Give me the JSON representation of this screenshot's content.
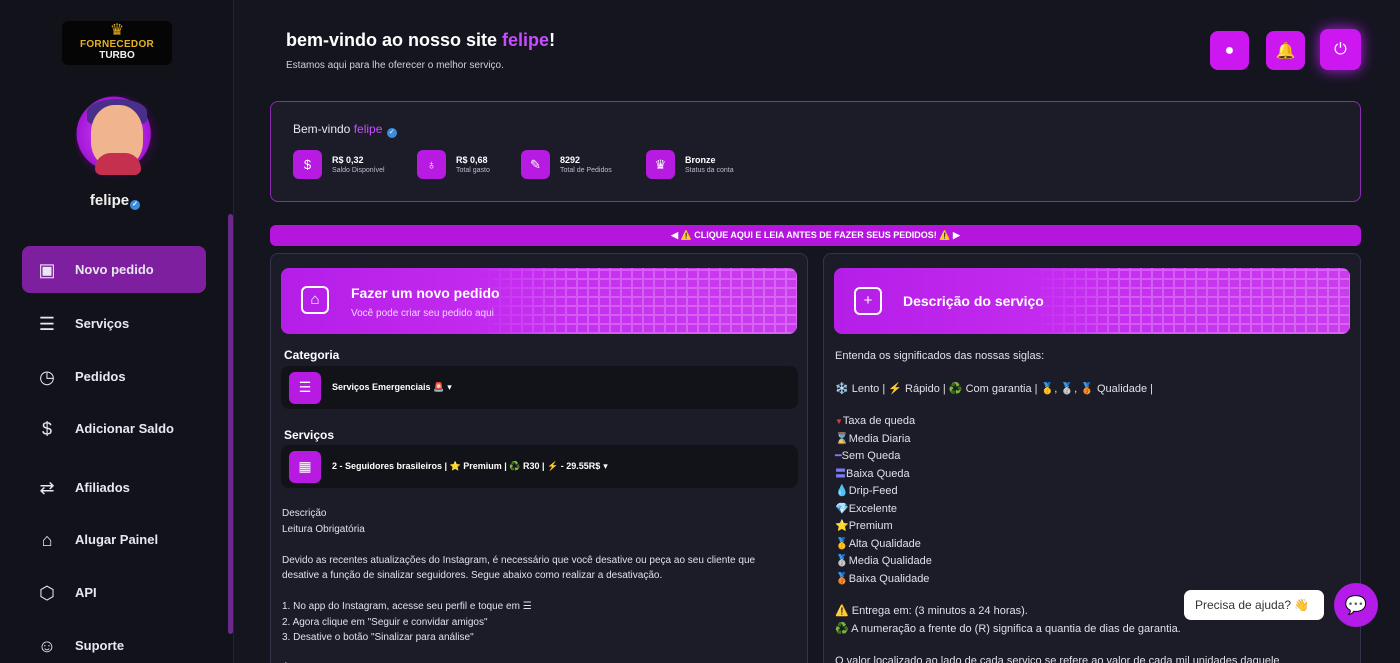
{
  "brand": {
    "logo_line1": "FORNECEDOR",
    "logo_line2": "TURBO",
    "crown": "♛"
  },
  "user": {
    "name": "felipe"
  },
  "nav": [
    {
      "label": "Novo pedido",
      "icon": "▣",
      "icon_name": "gift-box-icon",
      "active": true
    },
    {
      "label": "Serviços",
      "icon": "☰",
      "icon_name": "list-icon"
    },
    {
      "label": "Pedidos",
      "icon": "◷",
      "icon_name": "orders-clock-icon"
    },
    {
      "label": "Adicionar Saldo",
      "icon": "$",
      "icon_name": "add-balance-icon"
    },
    {
      "label": "Afiliados",
      "icon": "⇄",
      "icon_name": "handshake-icon"
    },
    {
      "label": "Alugar Painel",
      "icon": "⌂",
      "icon_name": "store-icon"
    },
    {
      "label": "API",
      "icon": "⬡",
      "icon_name": "api-icon"
    },
    {
      "label": "Suporte",
      "icon": "☺",
      "icon_name": "support-icon"
    }
  ],
  "header": {
    "title_prefix": "bem-vindo ao nosso site ",
    "title_name": "felipe",
    "title_suffix": "!",
    "subtitle": "Estamos aqui para lhe oferecer o melhor serviço.",
    "buttons": [
      {
        "icon": "●",
        "icon_name": "user-icon"
      },
      {
        "icon": "🔔",
        "icon_name": "bell-icon"
      },
      {
        "icon": "⏻",
        "icon_name": "power-icon"
      }
    ]
  },
  "stats": {
    "hello": "Bem-vindo ",
    "name": "felipe",
    "items": [
      {
        "value": "R$ 0,32",
        "label": "Saldo Disponível",
        "icon": "$",
        "icon_name": "dollar-icon"
      },
      {
        "value": "R$ 0,68",
        "label": "Total gasto",
        "icon": "♁",
        "icon_name": "hand-coin-icon"
      },
      {
        "value": "8292",
        "label": "Total de Pedidos",
        "icon": "✎",
        "icon_name": "feather-icon"
      },
      {
        "value": "Bronze",
        "label": "Status da conta",
        "icon": "♛",
        "icon_name": "rank-icon"
      }
    ]
  },
  "notice": "◀ ⚠️ CLIQUE AQUI E LEIA ANTES DE FAZER SEUS PEDIDOS! ⚠️ ▶",
  "order_panel": {
    "title": "Fazer um novo pedido",
    "subtitle": "Você pode criar seu pedido aqui",
    "icon": "⌂",
    "category_label": "Categoria",
    "category_value": "Serviços Emergenciais 🚨",
    "services_label": "Serviços",
    "service_value": "2 - Seguidores brasileiros | ⭐ Premium | ♻️ R30 | ⚡ - 29.55R$",
    "description": [
      "Descrição",
      "Leitura Obrigatória",
      "",
      "Devido as recentes atualizações do Instagram, é necessário que você desative ou peça ao seu cliente que",
      "desative a função de sinalizar seguidores. Segue abaixo como realizar a desativação.",
      "",
      "1. No app do Instagram, acesse seu perfil e toque em ☰",
      "2. Agora clique em \"Seguir e convidar amigos\"",
      "3. Desative o botão \"Sinalizar para análise\"",
      "",
      "É importante você se certificar que essa opção esteja desativada, caso contrário não entregaremos o seu pedido."
    ]
  },
  "service_panel": {
    "title": "Descrição do serviço",
    "icon": "+",
    "intro": "Entenda os significados das nossas siglas:",
    "legend": "❄️ Lento | ⚡ Rápido | ♻️ Com garantia | 🥇, 🥈, 🥉 Qualidade |",
    "items": [
      {
        "icon": "▼",
        "cls": "ico-red",
        "text": "Taxa de queda"
      },
      {
        "icon": "⌛",
        "cls": "ico-hour",
        "text": "Media Diaria"
      },
      {
        "icon": "━",
        "cls": "ico-line",
        "text": "Sem Queda"
      },
      {
        "icon": "〓",
        "cls": "ico-line",
        "text": "Baixa Queda"
      },
      {
        "icon": "💧",
        "cls": "ico-drop",
        "text": "Drip-Feed"
      },
      {
        "icon": "💎",
        "cls": "ico-gem",
        "text": "Excelente"
      },
      {
        "icon": "⭐",
        "cls": "ico-star",
        "text": "Premium"
      },
      {
        "icon": "🥇",
        "cls": "ico-med",
        "text": "Alta Qualidade"
      },
      {
        "icon": "🥈",
        "cls": "ico-med",
        "text": "Media Qualidade"
      },
      {
        "icon": "🥉",
        "cls": "ico-med",
        "text": "Baixa Qualidade"
      }
    ],
    "delivery": "⚠️ Entrega em: (3 minutos a 24 horas).",
    "guarantee": "♻️ A numeração a frente do (R) significa a quantia de dias de garantia.",
    "footer": "O valor localizado ao lado de cada serviço se refere ao valor de cada mil unidades daquele"
  },
  "chat": {
    "bubble": "Precisa de ajuda? 👋",
    "icon": "💬"
  }
}
